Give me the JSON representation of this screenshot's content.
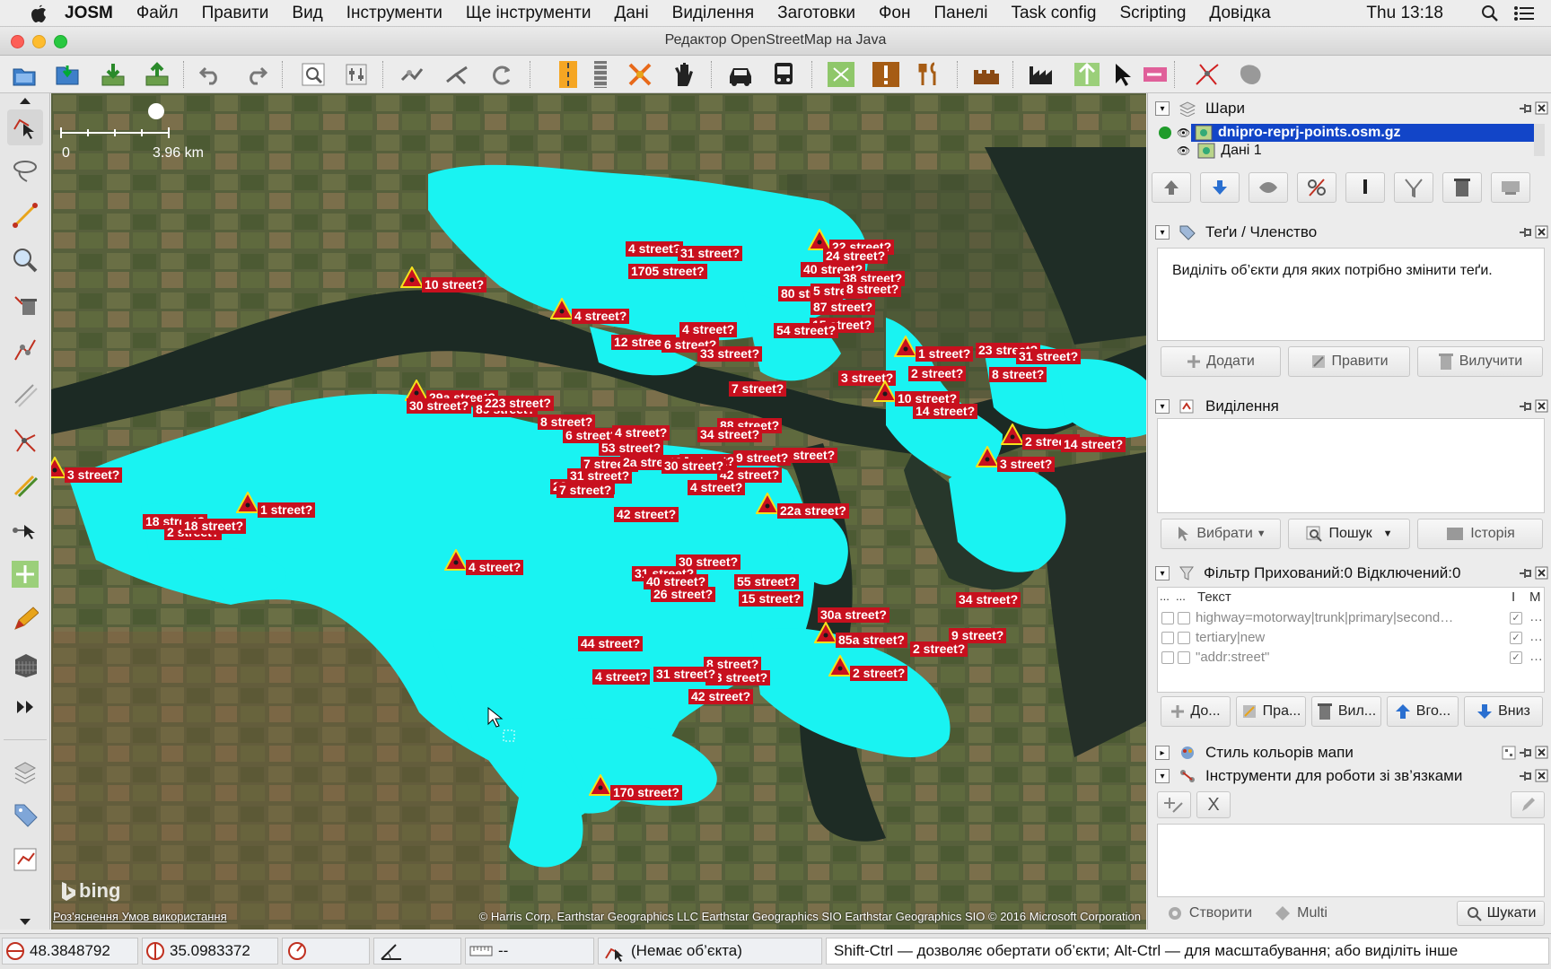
{
  "menubar": {
    "app": "JOSM",
    "items": [
      "Файл",
      "Правити",
      "Вид",
      "Інструменти",
      "Ще інструменти",
      "Дані",
      "Виділення",
      "Заготовки",
      "Фон",
      "Панелі",
      "Task config",
      "Scripting",
      "Довідка"
    ],
    "clock": "Thu 13:18"
  },
  "window": {
    "title": "Редактор OpenStreetMap на Java"
  },
  "map": {
    "scale_start": "0",
    "scale_end": "3.96 km",
    "provider": "bing",
    "terms": "Роз'яснення Умов використання",
    "attribution": "© Harris Corp, Earthstar Geographics LLC Earthstar Geographics  SIO Earthstar Geographics  SIO © 2016 Microsoft Corporation",
    "labels": [
      "10 street?",
      "4 street?",
      "31 street?",
      "1705 street?",
      "4 street?",
      "22 street?",
      "40 street?",
      "24 street?",
      "38 street?",
      "80 street?",
      "5 street?",
      "8 street?",
      "87 street?",
      "15 street?",
      "54 street?",
      "4 street?",
      "12 street?",
      "6 street?",
      "33 street?",
      "1 street?",
      "2 street?",
      "23 street?",
      "31 street?",
      "8 street?",
      "7 street?",
      "3 street?",
      "10 street?",
      "14 street?",
      "2 street?",
      "14 street?",
      "3 street?",
      "29a street?",
      "89 street?",
      "30 street?",
      "223 street?",
      "8 street?",
      "6 street?",
      "88 street?",
      "4 street?",
      "53 street?",
      "34 street?",
      "5 street?",
      "32 street?",
      "9 street?",
      "42 street?",
      "7 street?",
      "22 street?",
      "31 street?",
      "2a street?",
      "30 street?",
      "4 street?",
      "42 street?",
      "22a street?",
      "7 street?",
      "1 street?",
      "18 street?",
      "2 street?",
      "18 street?",
      "3 street?",
      "4 street?",
      "30 street?",
      "31 street?",
      "40 street?",
      "26 street?",
      "55 street?",
      "15 street?",
      "30a street?",
      "34 street?",
      "44 street?",
      "9 street?",
      "85a street?",
      "2 street?",
      "4 street?",
      "8 street?",
      "23 street?",
      "31 street?",
      "42 street?",
      "2 street?",
      "170 street?"
    ]
  },
  "layers": {
    "title": "Шари",
    "items": [
      {
        "name": "dnipro-reprj-points.osm.gz",
        "active": true
      },
      {
        "name": "Дані 1",
        "active": false
      }
    ]
  },
  "tags": {
    "title": "Теґи / Членство",
    "hint": "Виділіть об’єкти для яких потрібно змінити теґи.",
    "add": "Додати",
    "edit": "Правити",
    "delete": "Вилучити"
  },
  "selection": {
    "title": "Виділення",
    "select": "Вибрати",
    "search": "Пошук",
    "history": "Історія"
  },
  "filter": {
    "title": "Фільтр Прихований:0 Відключений:0",
    "col_text": "Текст",
    "col_i": "I",
    "col_m": "M",
    "col_dots": "...",
    "rows": [
      "highway=motorway|trunk|primary|second…",
      "tertiary|new",
      "\"addr:street\""
    ],
    "btn_add": "До...",
    "btn_edit": "Пра...",
    "btn_del": "Вил...",
    "btn_up": "Вго...",
    "btn_down": "Вниз"
  },
  "mapstyle": {
    "title": "Стиль кольорів мапи"
  },
  "relations": {
    "title": "Інструменти для роботи зі зв’язками",
    "btn_create": "Створити",
    "btn_multi": "Multi",
    "btn_search": "Шукати",
    "x_label": "X"
  },
  "status": {
    "lat": "48.3848792",
    "lon": "35.0983372",
    "dist": "--",
    "object": "(Немає об’єкта)",
    "hint": "Shift-Ctrl — дозволяє обертати об’єкти; Alt-Ctrl — для масштабування; або виділіть інше"
  },
  "colors": {
    "cyan": "#19f3f2",
    "red": "#c8101e",
    "selected": "#1245c8"
  }
}
